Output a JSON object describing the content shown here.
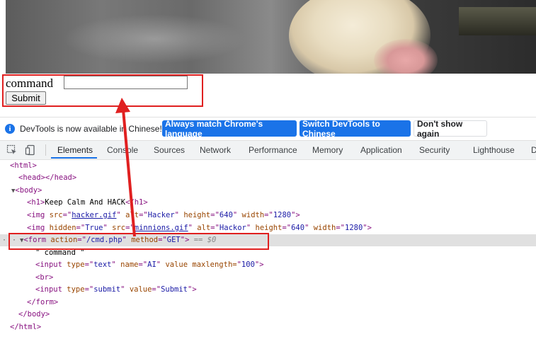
{
  "page": {
    "command_label": "command",
    "input_value": "",
    "submit_label": "Submit"
  },
  "info_bar": {
    "message": "DevTools is now available in Chinese!",
    "btn_match": "Always match Chrome's language",
    "btn_switch": "Switch DevTools to Chinese",
    "btn_dont_show": "Don't show again"
  },
  "tabs": [
    "Elements",
    "Console",
    "Sources",
    "Network",
    "Performance",
    "Memory",
    "Application",
    "Security",
    "Lighthouse",
    "D"
  ],
  "dom": {
    "html_open": "<html>",
    "head": "<head></head>",
    "body_open": "<body>",
    "h1_text": "Keep Calm And HACK",
    "img1": {
      "src": "hacker.gif",
      "alt": "Hacker",
      "height": "640",
      "width": "1280"
    },
    "img2": {
      "hidden": "True",
      "src": "minnions.gif",
      "alt": "Hackor",
      "height": "640",
      "width": "1280"
    },
    "form": {
      "action": "/cmd.php",
      "method": "GET",
      "marker": "== $0"
    },
    "text_node": "\" command \"",
    "input1": {
      "type": "text",
      "name": "AI",
      "extra": "value maxlength=",
      "maxlength": "100"
    },
    "br": "<br>",
    "input2": {
      "type": "submit",
      "value": "Submit"
    },
    "form_close": "</form>",
    "body_close": "</body>",
    "html_close": "</html>"
  },
  "colors": {
    "highlight": "#e02020",
    "accent": "#1a73e8",
    "tag": "#881280",
    "attr": "#994500",
    "value": "#1a1aa6"
  }
}
